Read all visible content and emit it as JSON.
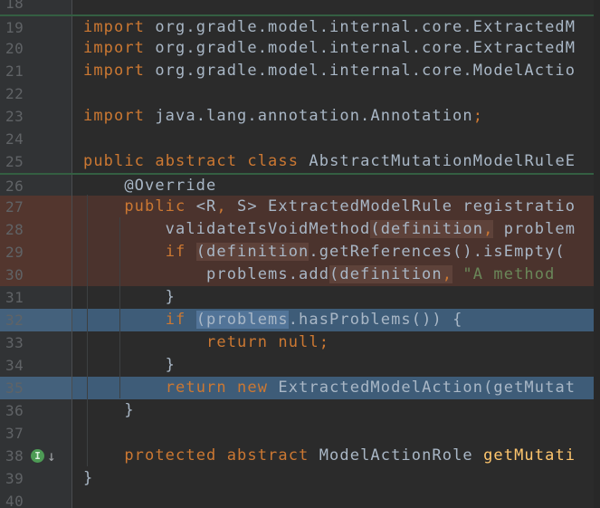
{
  "app": {
    "name": "ide-code-editor",
    "theme": "darcula"
  },
  "colors": {
    "editor_background": "#2b2b2b",
    "gutter_background": "#313335",
    "line_number": "#606366",
    "keyword": "#CC7832",
    "plain_text": "#A9B7C6",
    "string": "#6A8759",
    "method_declaration": "#FFC66D",
    "punctuation": "#CC7832",
    "diff_deleted_row": "#4b332d",
    "diff_deleted_word": "#5e423a",
    "diff_changed_row": "#3e5c78",
    "diff_changed_word": "#527498",
    "diff_separator_line": "#345f42",
    "implemented_marker_green": "#4d9b55"
  },
  "editor": {
    "first_line_number": 18,
    "last_line_number": 40,
    "lines": [
      {
        "num": "18",
        "bg": "",
        "sep": false,
        "segs": []
      },
      {
        "num": "19",
        "bg": "",
        "sep": true,
        "segs": [
          [
            "import",
            "k"
          ],
          [
            " org.gradle.model.internal.core.ExtractedM",
            "t"
          ]
        ]
      },
      {
        "num": "20",
        "bg": "",
        "sep": false,
        "segs": [
          [
            "import",
            "k"
          ],
          [
            " org.gradle.model.internal.core.ExtractedM",
            "t"
          ]
        ]
      },
      {
        "num": "21",
        "bg": "",
        "sep": false,
        "segs": [
          [
            "import",
            "k"
          ],
          [
            " org.gradle.model.internal.core.ModelActio",
            "t"
          ]
        ]
      },
      {
        "num": "22",
        "bg": "",
        "sep": false,
        "segs": []
      },
      {
        "num": "23",
        "bg": "",
        "sep": false,
        "segs": [
          [
            "import",
            "k"
          ],
          [
            " java.lang.annotation.Annotation",
            "t"
          ],
          [
            ";",
            "p"
          ]
        ]
      },
      {
        "num": "24",
        "bg": "",
        "sep": false,
        "segs": []
      },
      {
        "num": "25",
        "bg": "",
        "sep": false,
        "segs": [
          [
            "public",
            "k"
          ],
          [
            " ",
            "t"
          ],
          [
            "abstract",
            "k"
          ],
          [
            " ",
            "t"
          ],
          [
            "class",
            "k"
          ],
          [
            " AbstractMutationModelRuleE",
            "t"
          ]
        ]
      },
      {
        "num": "26",
        "bg": "",
        "sep": true,
        "segs": [
          [
            "    @Override",
            "t"
          ]
        ]
      },
      {
        "num": "27",
        "bg": "r",
        "sep": false,
        "segs": [
          [
            "    ",
            "t"
          ],
          [
            "public",
            "k"
          ],
          [
            " <R",
            "t"
          ],
          [
            ",",
            "p"
          ],
          [
            " S> ExtractedModelRule registratio",
            "t"
          ]
        ]
      },
      {
        "num": "28",
        "bg": "r",
        "sep": false,
        "segs": [
          [
            "        validateIsVoidMethod",
            "t"
          ],
          [
            "(definition",
            "t",
            "r"
          ],
          [
            ",",
            "p",
            "r"
          ],
          [
            " problem",
            "t"
          ]
        ]
      },
      {
        "num": "29",
        "bg": "r",
        "sep": false,
        "segs": [
          [
            "        ",
            "t"
          ],
          [
            "if",
            "k"
          ],
          [
            " ",
            "t"
          ],
          [
            "(definition",
            "t",
            "r"
          ],
          [
            ".getReferences().isEmpty(",
            "t"
          ]
        ]
      },
      {
        "num": "30",
        "bg": "r",
        "sep": false,
        "segs": [
          [
            "            problems.add",
            "t"
          ],
          [
            "(definition",
            "t",
            "r"
          ],
          [
            ",",
            "p",
            "r"
          ],
          [
            " ",
            "t"
          ],
          [
            "\"A method ",
            "s"
          ]
        ]
      },
      {
        "num": "31",
        "bg": "",
        "sep": false,
        "segs": [
          [
            "        }",
            "t"
          ]
        ]
      },
      {
        "num": "32",
        "bg": "b",
        "sep": false,
        "segs": [
          [
            "        ",
            "t"
          ],
          [
            "if",
            "k"
          ],
          [
            " ",
            "t"
          ],
          [
            "(problems",
            "t",
            "b"
          ],
          [
            ".hasProblems()) {",
            "t"
          ]
        ]
      },
      {
        "num": "33",
        "bg": "",
        "sep": false,
        "segs": [
          [
            "            ",
            "t"
          ],
          [
            "return",
            "k"
          ],
          [
            " ",
            "t"
          ],
          [
            "null",
            "k"
          ],
          [
            ";",
            "p"
          ]
        ]
      },
      {
        "num": "34",
        "bg": "",
        "sep": false,
        "segs": [
          [
            "        }",
            "t"
          ]
        ]
      },
      {
        "num": "35",
        "bg": "b",
        "sep": false,
        "segs": [
          [
            "        ",
            "t"
          ],
          [
            "return",
            "k"
          ],
          [
            " ",
            "t"
          ],
          [
            "new",
            "k"
          ],
          [
            " ExtractedModelAction(getMutat",
            "t"
          ]
        ]
      },
      {
        "num": "36",
        "bg": "",
        "sep": false,
        "segs": [
          [
            "    }",
            "t"
          ]
        ]
      },
      {
        "num": "37",
        "bg": "",
        "sep": false,
        "segs": []
      },
      {
        "num": "38",
        "bg": "",
        "sep": false,
        "icon": true,
        "segs": [
          [
            "    ",
            "t"
          ],
          [
            "protected",
            "k"
          ],
          [
            " ",
            "t"
          ],
          [
            "abstract",
            "k"
          ],
          [
            " ModelActionRole ",
            "t"
          ],
          [
            "getMutati",
            "m"
          ]
        ]
      },
      {
        "num": "39",
        "bg": "",
        "sep": false,
        "segs": [
          [
            "}",
            "t"
          ]
        ]
      },
      {
        "num": "40",
        "bg": "",
        "sep": false,
        "segs": []
      }
    ],
    "gutter_icon": {
      "line": "38",
      "name": "implemented-marker-icon",
      "letter": "I",
      "arrow": "↓"
    }
  }
}
